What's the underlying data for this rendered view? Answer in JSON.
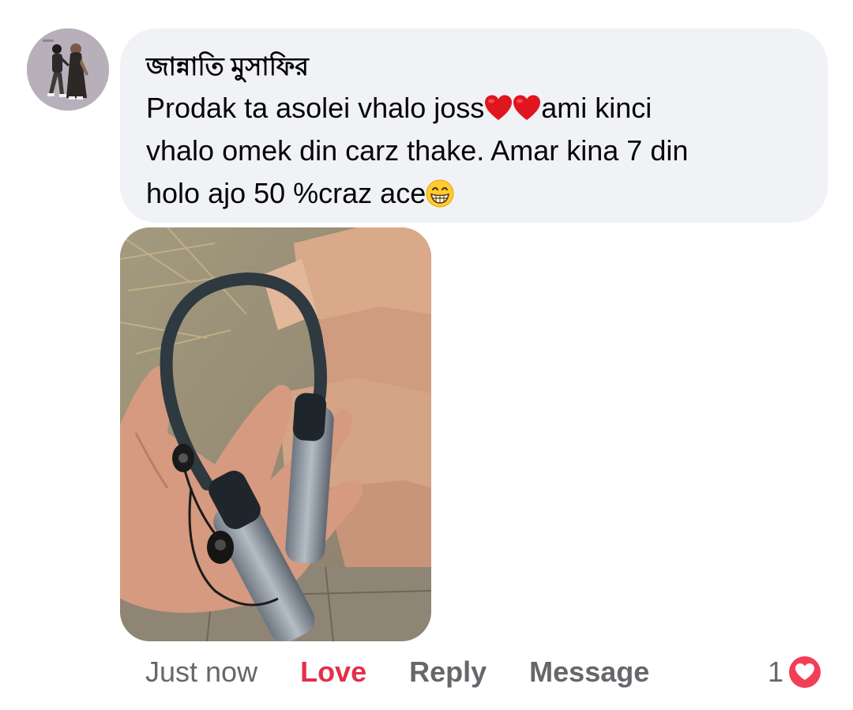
{
  "comment": {
    "author": "জান্নাতি মুসাফির",
    "line1": "Prodak ta asolei vhalo joss",
    "line1b": "ami kinci",
    "line2": "vhalo omek din carz thake. Amar kina 7 din",
    "line3": "holo ajo 50 %craz ace"
  },
  "actions": {
    "time": "Just now",
    "love": "Love",
    "reply": "Reply",
    "message": "Message"
  },
  "reactions": {
    "count": "1"
  },
  "icons": {
    "avatar": "profile-avatar-couple",
    "heart": "red-heart-emoji",
    "grin": "grinning-face-emoji",
    "reaction": "love-reaction-icon"
  },
  "colors": {
    "bubble": "#f0f2f5",
    "love": "#e42f4a",
    "muted": "#65676b"
  }
}
